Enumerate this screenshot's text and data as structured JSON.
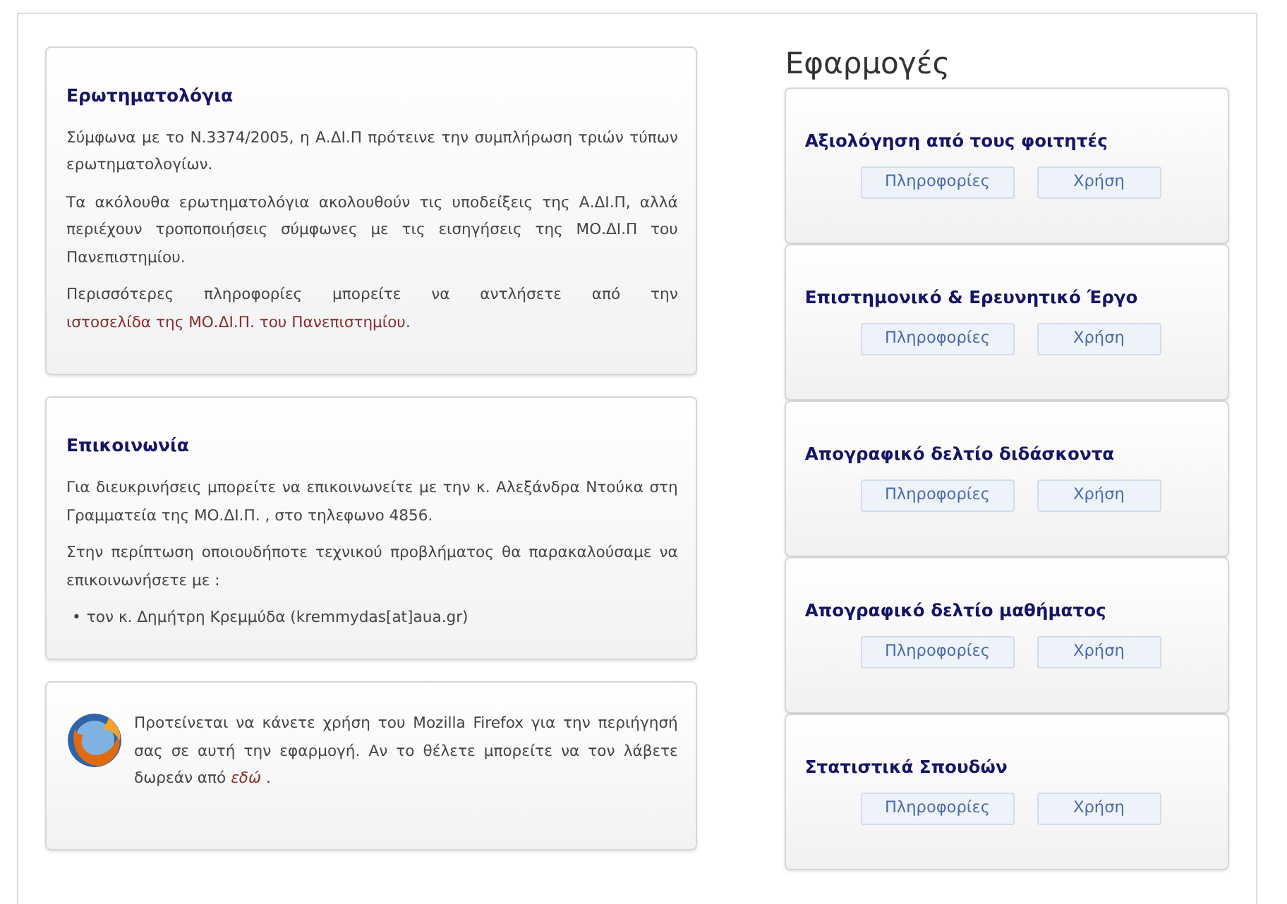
{
  "info_cards": [
    {
      "kind": "text",
      "title": "Ερωτηματολόγια",
      "paragraphs": [
        [
          {
            "kind": "text",
            "text": "Σύμφωνα με το Ν.3374/2005, η Α.ΔΙ.Π πρότεινε την συμπλήρωση τριών τύπων ερωτηματολογίων."
          }
        ],
        [
          {
            "kind": "text",
            "text": "Τα ακόλουθα ερωτηματολόγια ακολουθούν τις υποδείξεις της Α.ΔΙ.Π, αλλά περιέχουν τροποποιήσεις σύμφωνες με τις εισηγήσεις της ΜΟ.ΔΙ.Π του Πανεπιστημίου."
          }
        ],
        [
          {
            "kind": "text",
            "text": "Περισσότερες πληροφορίες μπορείτε να αντλήσετε από την "
          },
          {
            "kind": "link",
            "text": "ιστοσελίδα της ΜΟ.ΔΙ.Π. του Πανεπιστημίου"
          },
          {
            "kind": "text",
            "text": "."
          }
        ]
      ]
    },
    {
      "kind": "text",
      "title": "Επικοινωνία",
      "paragraphs": [
        [
          {
            "kind": "text",
            "text": "Για διευκρινήσεις μπορείτε να επικοινωνείτε με την κ. Αλεξάνδρα Ντούκα στη Γραμματεία της ΜΟ.ΔΙ.Π. , στο τηλεφωνο 4856."
          }
        ],
        [
          {
            "kind": "text",
            "text": "Στην περίπτωση οποιουδήποτε τεχνικού προβλήματος θα παρακαλούσαμε να επικοινωνήσετε με :"
          }
        ]
      ],
      "bullets": [
        {
          "marker": "•",
          "text": "τον κ. Δημήτρη Κρεμμύδα (kremmydas[at]aua.gr)"
        }
      ]
    },
    {
      "kind": "browser",
      "paragraphs": [
        [
          {
            "kind": "text",
            "text": "Προτείνεται να κάνετε χρήση του Mozilla Firefox για την περιήγησή σας σε αυτή την εφαρμογή. Αν το θέλετε μπορείτε να τον λάβετε δωρεάν από "
          },
          {
            "kind": "emlink",
            "text": "εδώ"
          },
          {
            "kind": "text",
            "text": " ."
          }
        ]
      ]
    }
  ],
  "apps": {
    "heading": "Εφαρμογές",
    "items": [
      {
        "title": "Αξιολόγηση από τους φοιτητές",
        "buttons": [
          "Πληροφορίες",
          "Χρήση"
        ]
      },
      {
        "title": "Επιστημονικό & Ερευνητικό Έργο",
        "buttons": [
          "Πληροφορίες",
          "Χρήση"
        ]
      },
      {
        "title": "Απογραφικό δελτίο διδάσκοντα",
        "buttons": [
          "Πληροφορίες",
          "Χρήση"
        ]
      },
      {
        "title": "Απογραφικό δελτίο μαθήματος",
        "buttons": [
          "Πληροφορίες",
          "Χρήση"
        ]
      },
      {
        "title": "Στατιστικά Σπουδών",
        "buttons": [
          "Πληροφορίες",
          "Χρήση"
        ]
      }
    ]
  }
}
